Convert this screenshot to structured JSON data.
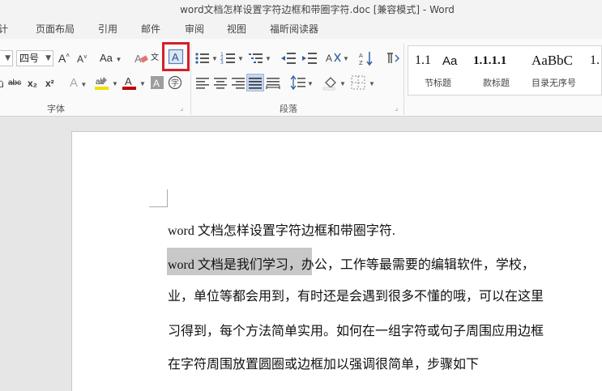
{
  "window": {
    "title": "word文档怎样设置字符边框和带圈字符.doc [兼容模式] - Word"
  },
  "tabs": [
    "设计",
    "页面布局",
    "引用",
    "邮件",
    "审阅",
    "视图",
    "福昕阅读器"
  ],
  "tabs_visible": [
    "计",
    "页面布局",
    "引用",
    "邮件",
    "审阅",
    "视图",
    "福昕阅读器"
  ],
  "ribbon": {
    "font_size": "四号",
    "change_case_label": "Aa",
    "subscript_label": "x₂",
    "superscript_label": "x²",
    "strikethrough_label": "abc",
    "groups": {
      "font": "字体",
      "paragraph": "段落"
    },
    "highlight_color": "#f0e000",
    "font_color": "#c00000",
    "accent_color": "#d61f26"
  },
  "styles": [
    {
      "sample": "1.1",
      "name": ""
    },
    {
      "sample": "Aa",
      "name": "节标题"
    },
    {
      "sample": "1.1.1.1",
      "name": "款标题"
    },
    {
      "sample": "AaBbC",
      "name": "目录无序号"
    },
    {
      "sample": "1.",
      "name": ""
    }
  ],
  "styles_names_visible": [
    "节标题",
    "款标题",
    "目录无序号"
  ],
  "document": {
    "lines": [
      "word 文档怎样设置字符边框和带圈字符.",
      "word  文档是我们学习，办公，工作等最需要的编辑软件，学校，",
      "业，单位等都会用到，有时还是会遇到很多不懂的哦，可以在这里",
      "习得到，每个方法简单实用。如何在一组字符或句子周围应用边框",
      "在字符周围放置圆圈或边框加以强调很简单，步骤如下"
    ],
    "selected_text": "word  文档是我们学习"
  }
}
